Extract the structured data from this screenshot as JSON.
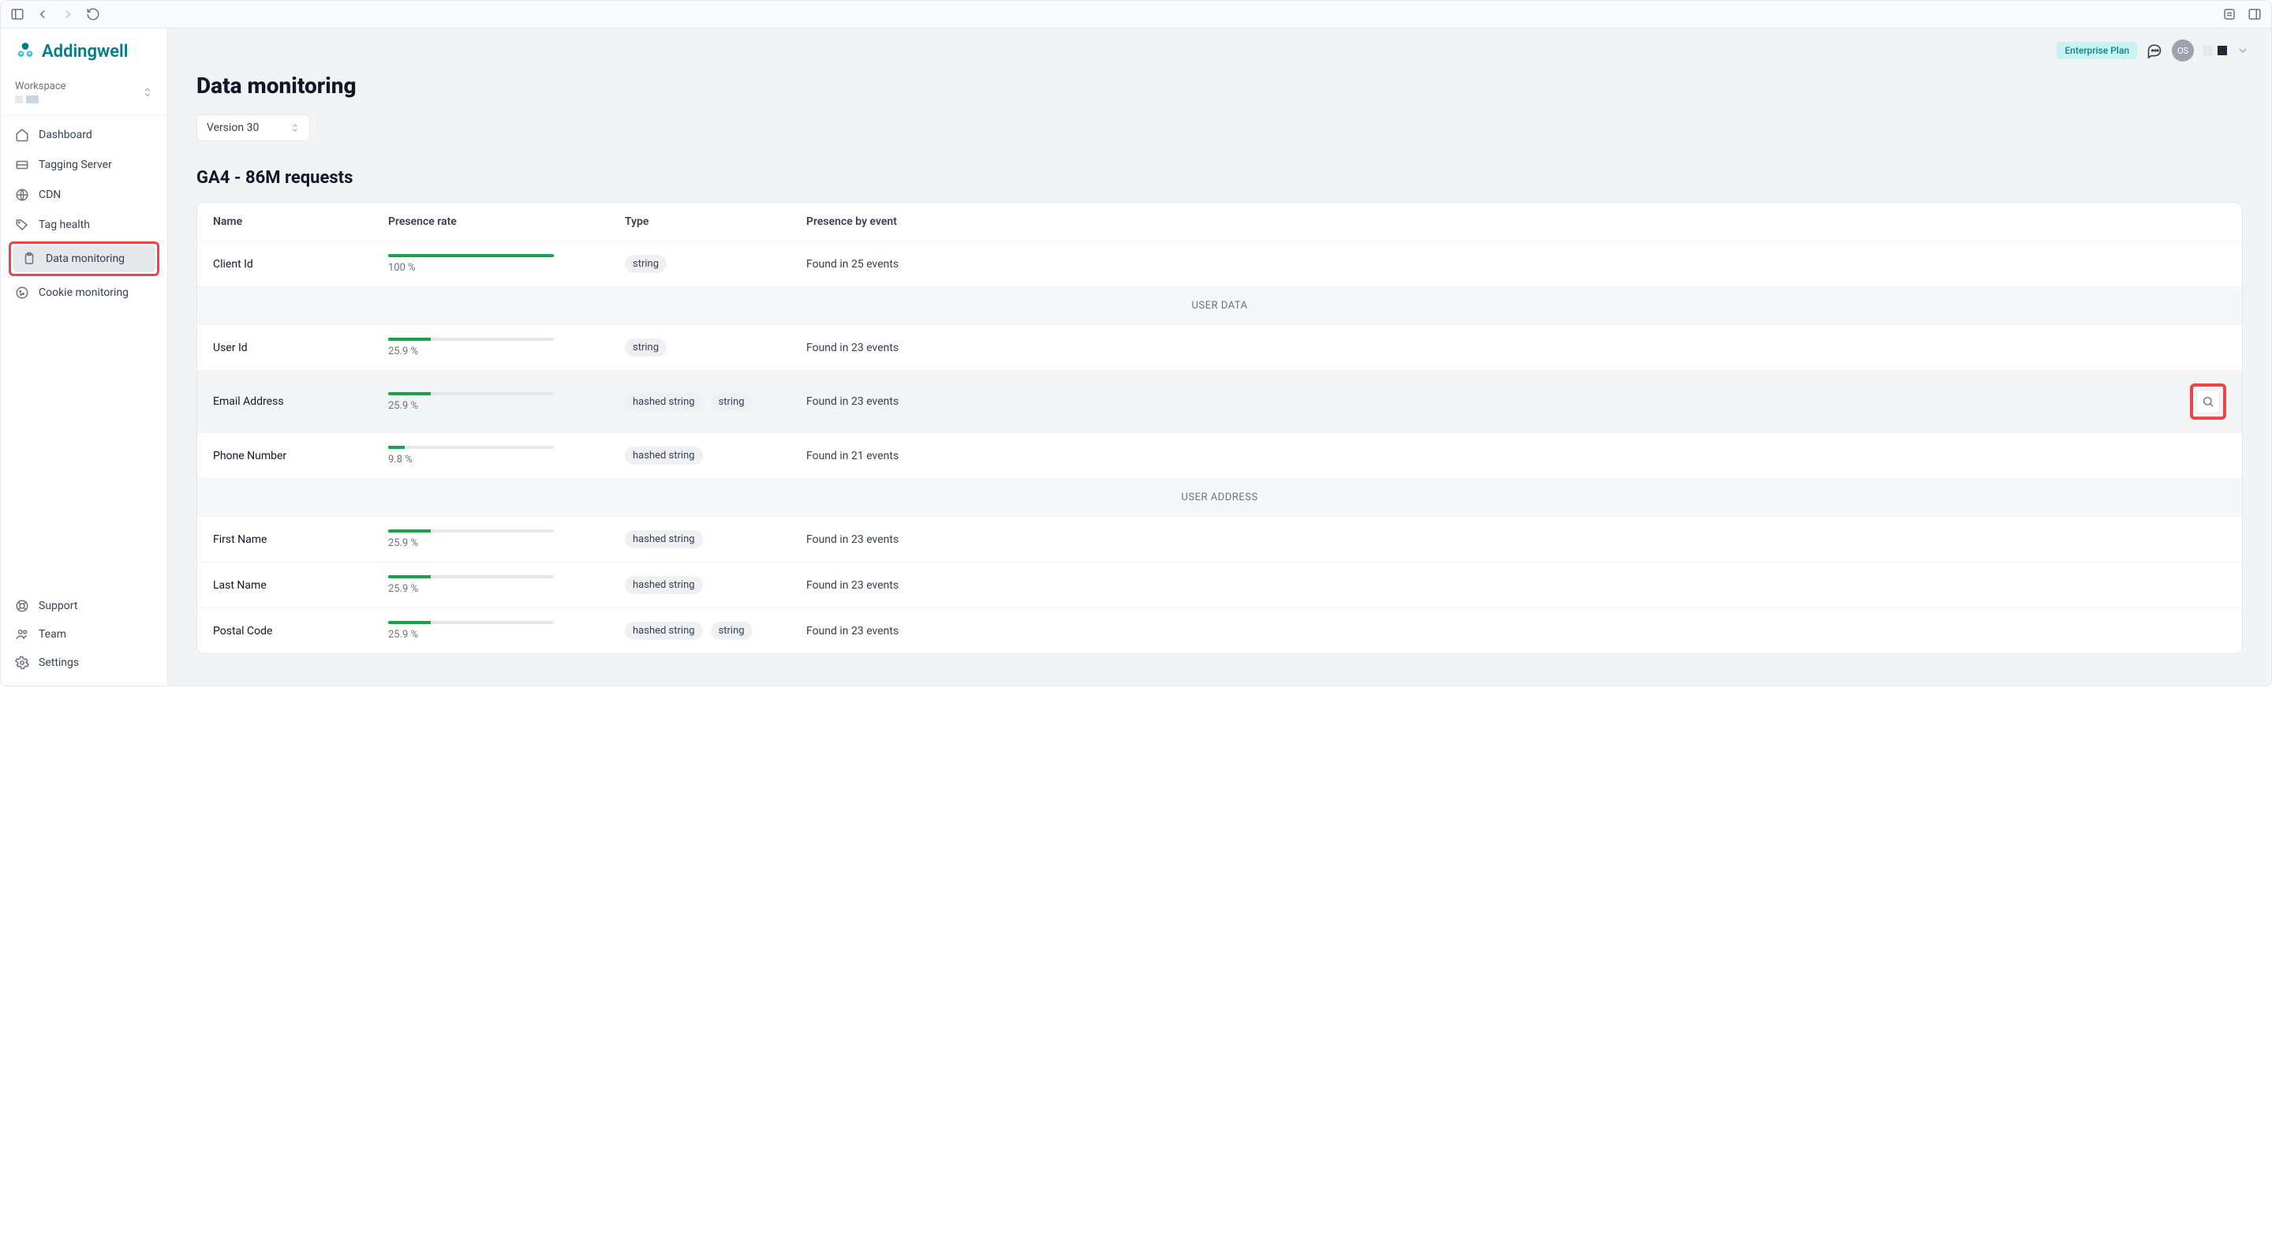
{
  "brand": {
    "name": "Addingwell"
  },
  "workspace": {
    "label": "Workspace"
  },
  "sidebar": {
    "items": [
      {
        "label": "Dashboard"
      },
      {
        "label": "Tagging Server"
      },
      {
        "label": "CDN"
      },
      {
        "label": "Tag health"
      },
      {
        "label": "Data monitoring",
        "active": true
      },
      {
        "label": "Cookie monitoring"
      }
    ],
    "bottom": [
      {
        "label": "Support"
      },
      {
        "label": "Team"
      },
      {
        "label": "Settings"
      }
    ]
  },
  "topbar": {
    "plan_badge": "Enterprise Plan",
    "avatar_initials": "OS"
  },
  "page": {
    "title": "Data monitoring",
    "version_label": "Version 30",
    "section_title": "GA4 - 86M requests"
  },
  "table": {
    "headers": {
      "name": "Name",
      "presence": "Presence rate",
      "type": "Type",
      "event": "Presence by event"
    },
    "groups": {
      "user_data": "USER DATA",
      "user_address": "USER ADDRESS"
    },
    "rows": {
      "client_id": {
        "name": "Client Id",
        "pct": 100,
        "pct_label": "100 %",
        "types": [
          "string"
        ],
        "event": "Found in 25 events"
      },
      "user_id": {
        "name": "User Id",
        "pct": 25.9,
        "pct_label": "25.9 %",
        "types": [
          "string"
        ],
        "event": "Found in 23 events"
      },
      "email": {
        "name": "Email Address",
        "pct": 25.9,
        "pct_label": "25.9 %",
        "types": [
          "hashed string",
          "string"
        ],
        "event": "Found in 23 events"
      },
      "phone": {
        "name": "Phone Number",
        "pct": 9.8,
        "pct_label": "9.8 %",
        "types": [
          "hashed string"
        ],
        "event": "Found in 21 events"
      },
      "first_name": {
        "name": "First Name",
        "pct": 25.9,
        "pct_label": "25.9 %",
        "types": [
          "hashed string"
        ],
        "event": "Found in 23 events"
      },
      "last_name": {
        "name": "Last Name",
        "pct": 25.9,
        "pct_label": "25.9 %",
        "types": [
          "hashed string"
        ],
        "event": "Found in 23 events"
      },
      "postal_code": {
        "name": "Postal Code",
        "pct": 25.9,
        "pct_label": "25.9 %",
        "types": [
          "hashed string",
          "string"
        ],
        "event": "Found in 23 events"
      }
    }
  }
}
